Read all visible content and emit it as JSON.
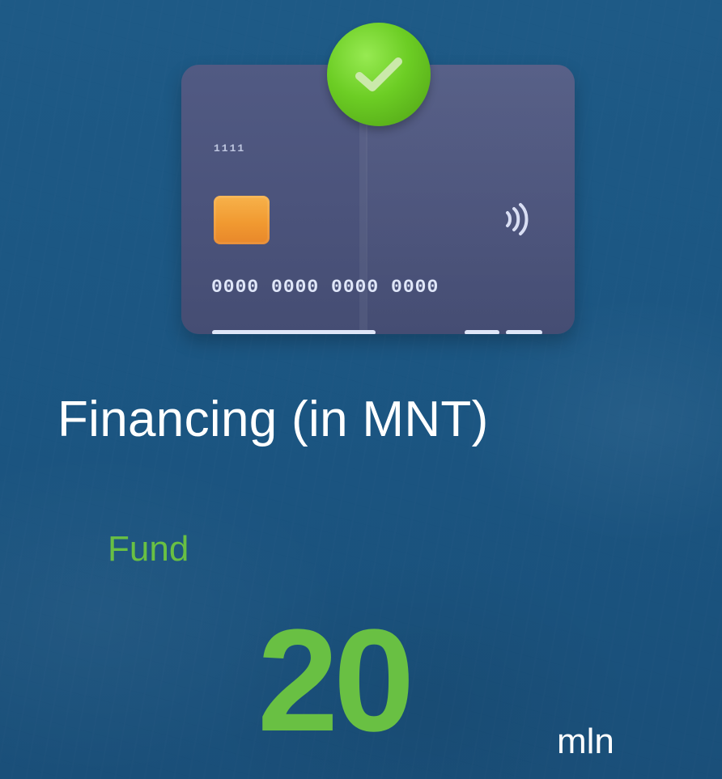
{
  "card": {
    "code_label": "1111",
    "number": "0000 0000 0000 0000",
    "check_icon": "check-icon",
    "contactless_icon": "contactless-icon",
    "chip_icon": "chip-icon"
  },
  "content": {
    "title": "Financing (in MNT)",
    "fund_label": "Fund",
    "amount": "20",
    "unit": "mln"
  },
  "colors": {
    "background": "#1e5a86",
    "card": "#4b537b",
    "accent_green": "#69c043",
    "white": "#ffffff",
    "chip": "#f19a31"
  }
}
